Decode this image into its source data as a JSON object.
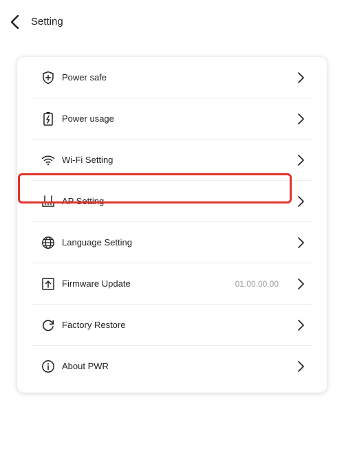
{
  "header": {
    "title": "Setting",
    "back_icon": "chevron-left-icon"
  },
  "menu": {
    "items": [
      {
        "label": "Power safe",
        "icon": "shield-plus-icon",
        "value": ""
      },
      {
        "label": "Power usage",
        "icon": "battery-bolt-icon",
        "value": ""
      },
      {
        "label": "Wi-Fi Setting",
        "icon": "wifi-icon",
        "value": ""
      },
      {
        "label": "AP Setting",
        "icon": "router-icon",
        "value": ""
      },
      {
        "label": "Language Setting",
        "icon": "globe-icon",
        "value": "",
        "highlighted": true
      },
      {
        "label": "Firmware Update",
        "icon": "upload-icon",
        "value": "01.00.00.00"
      },
      {
        "label": "Factory Restore",
        "icon": "restore-icon",
        "value": ""
      },
      {
        "label": "About PWR",
        "icon": "info-icon",
        "value": ""
      }
    ],
    "chevron_icon": "chevron-right-icon"
  },
  "colors": {
    "highlight_border": "#e2332a",
    "divider": "#ececec",
    "value_text": "#9a9a9a"
  }
}
